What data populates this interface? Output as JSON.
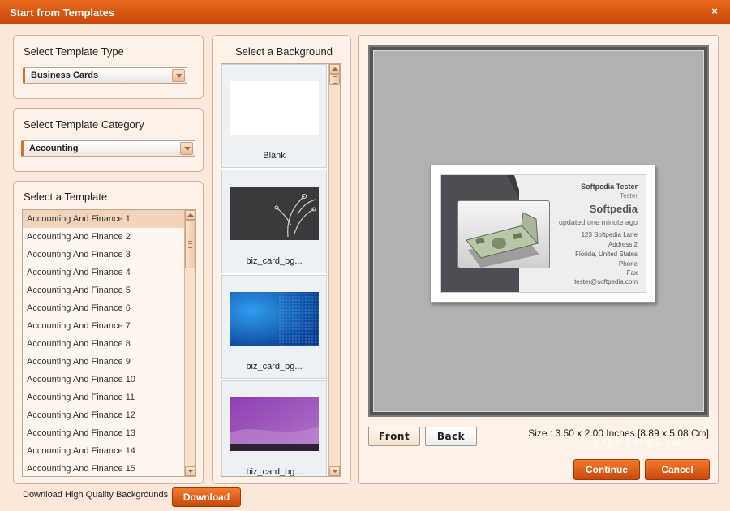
{
  "window": {
    "title": "Start from Templates",
    "close_glyph": "×"
  },
  "template_type": {
    "label": "Select Template Type",
    "value": "Business Cards"
  },
  "template_category": {
    "label": "Select Template Category",
    "value": "Accounting"
  },
  "templates": {
    "label": "Select a Template",
    "items": [
      "Accounting And Finance 1",
      "Accounting And Finance 2",
      "Accounting And Finance 3",
      "Accounting And Finance 4",
      "Accounting And Finance 5",
      "Accounting And Finance 6",
      "Accounting And Finance 7",
      "Accounting And Finance 8",
      "Accounting And Finance 9",
      "Accounting And Finance 10",
      "Accounting And Finance 11",
      "Accounting And Finance 12",
      "Accounting And Finance 13",
      "Accounting And Finance 14",
      "Accounting And Finance 15"
    ],
    "selected_index": 0
  },
  "backgrounds": {
    "label": "Select a Background",
    "items": [
      {
        "caption": "Blank",
        "style": "blank"
      },
      {
        "caption": "biz_card_bg...",
        "style": "dark-floral"
      },
      {
        "caption": "biz_card_bg...",
        "style": "blue-halftone"
      },
      {
        "caption": "biz_card_bg...",
        "style": "purple-wave"
      }
    ]
  },
  "card": {
    "name": "Softpedia Tester",
    "role": "Tester",
    "company": "Softpedia",
    "updated": "updated one minute ago",
    "address_lines": [
      "123 Softpedia Lane",
      "Address 2",
      "Florida, United States",
      "Phone",
      "Fax",
      "tester@softpedia.com"
    ]
  },
  "preview": {
    "front_label": "Front",
    "back_label": "Back",
    "active_side": "front",
    "size_text": "Size : 3.50 x 2.00 Inches [8.89 x 5.08 Cm]"
  },
  "actions": {
    "continue_label": "Continue",
    "cancel_label": "Cancel"
  },
  "download": {
    "text": "Download High Quality Backgrounds",
    "button_label": "Download"
  },
  "watermark": "SOFTPEDIA",
  "colors": {
    "accent": "#e0641a",
    "title_bar": "#d2540f",
    "panel_bg": "#fdf1e8"
  }
}
